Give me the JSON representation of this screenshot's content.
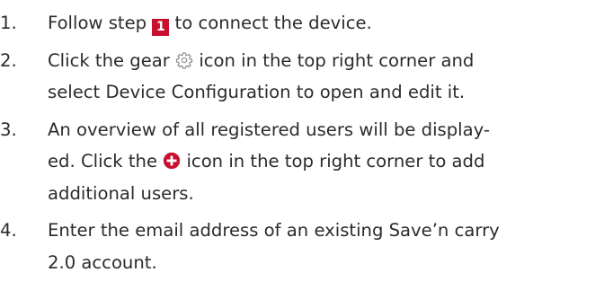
{
  "steps": [
    {
      "number": "1.",
      "lines": [
        {
          "pre": "Follow step ",
          "badge": "1",
          "post": " to connect the device."
        }
      ]
    },
    {
      "number": "2.",
      "lines": [
        {
          "pre": "Click the gear ",
          "icon": "gear-icon",
          "post": " icon in the top right corner and"
        },
        {
          "text": "select Device Configuration to open and edit it."
        }
      ]
    },
    {
      "number": "3.",
      "lines": [
        {
          "text": "An overview of all registered users will be display-"
        },
        {
          "pre": "ed. Click the ",
          "icon": "plus-circle-icon",
          "post": " icon in the top right corner to add"
        },
        {
          "text": "additional users."
        }
      ]
    },
    {
      "number": "4.",
      "lines": [
        {
          "text": "Enter the email address of an existing Save’n carry"
        },
        {
          "text": "2.0 account."
        }
      ]
    }
  ],
  "colors": {
    "text": "#2b2b2b",
    "accent": "#c8102e",
    "gear_icon": "#8a8a8a"
  }
}
